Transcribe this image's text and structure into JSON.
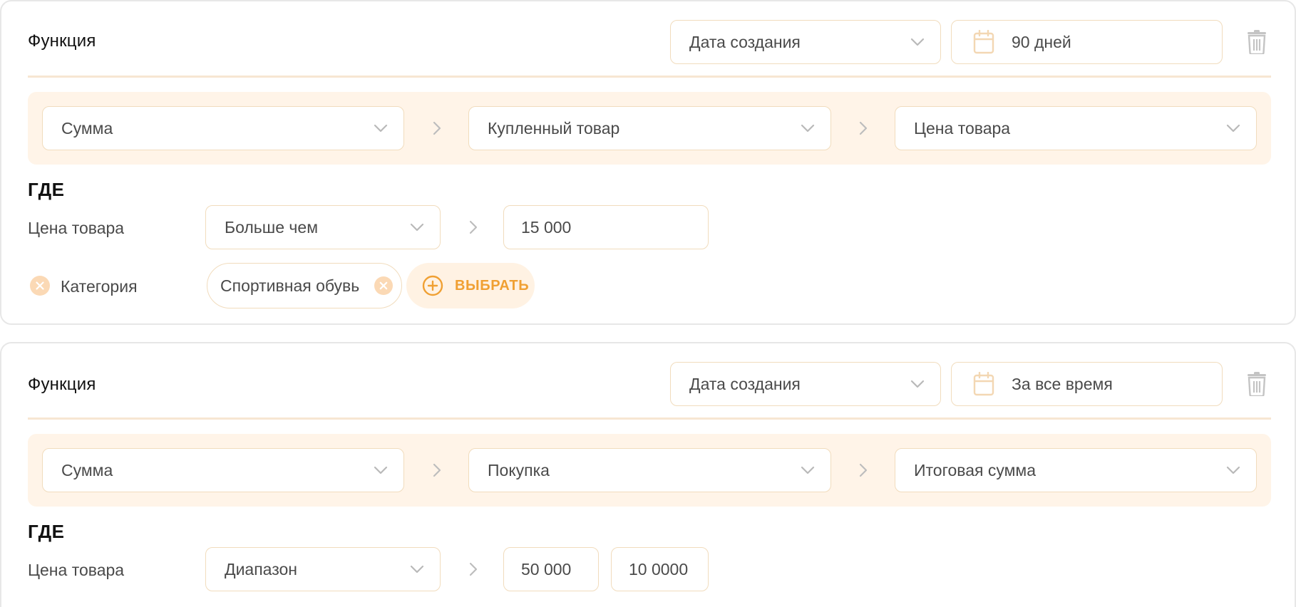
{
  "colors": {
    "accent": "#f0a033",
    "border": "#f1dcbd",
    "path_bg": "#fff4e8",
    "icon_gray": "#bdbdbd"
  },
  "icons": [
    "chevron-down-icon",
    "calendar-icon",
    "trash-icon",
    "chevron-right-icon",
    "close-circle-icon",
    "plus-circle-icon"
  ],
  "blocks": [
    {
      "title": "Функция",
      "date_field": "Дата создания",
      "period": "90 дней",
      "path": [
        "Сумма",
        "Купленный товар",
        "Цена товара"
      ],
      "where_label": "ГДЕ",
      "conditions": [
        {
          "field": "Цена товара",
          "operator": "Больше чем",
          "value": "15 000"
        }
      ],
      "category_filter": {
        "label": "Категория",
        "chip": "Спортивная обувь",
        "add_label": "ВЫБРАТЬ"
      }
    },
    {
      "title": "Функция",
      "date_field": "Дата создания",
      "period": "За все время",
      "path": [
        "Сумма",
        "Покупка",
        "Итоговая сумма"
      ],
      "where_label": "ГДЕ",
      "conditions": [
        {
          "field": "Цена товара",
          "operator": "Диапазон",
          "value_from": "50 000",
          "value_to": "10 0000"
        }
      ]
    }
  ]
}
